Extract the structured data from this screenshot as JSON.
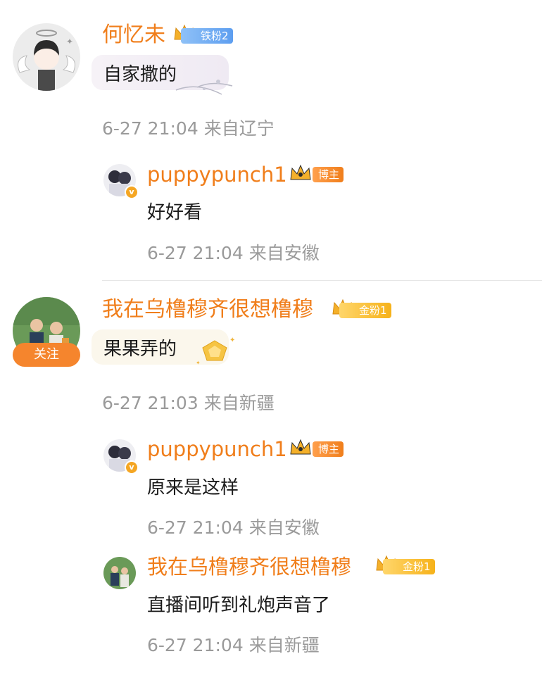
{
  "comments": [
    {
      "username": "何忆未",
      "badge": "铁粉2",
      "text": "自家撒的",
      "time": "6-27 21:04",
      "location": "来自辽宁",
      "reply": {
        "username": "puppypunch1",
        "badge": "博主",
        "text": "好好看",
        "time": "6-27 21:04",
        "location": "来自安徽"
      }
    },
    {
      "username": "我在乌橹穆齐很想橹穆",
      "badge": "金粉1",
      "follow_label": "关注",
      "text": "果果弄的",
      "time": "6-27 21:03",
      "location": "来自新疆",
      "replies": [
        {
          "username": "puppypunch1",
          "badge": "博主",
          "text": "原来是这样",
          "time": "6-27 21:04",
          "location": "来自安徽"
        },
        {
          "username": "我在乌橹穆齐很想橹穆",
          "badge": "金粉1",
          "text": "直播间听到礼炮声音了",
          "time": "6-27 21:04",
          "location": "来自新疆"
        }
      ]
    }
  ],
  "colors": {
    "username": "#f07e1b",
    "meta": "#9a9a9a",
    "follow_button": "#f5852d",
    "fan_badge_blue": "#5d9ef0",
    "fan_badge_gold": "#f6b21a"
  },
  "icons": [
    "crown-icon",
    "verified-v-icon",
    "sparkle-icon",
    "bubble-decoration"
  ]
}
